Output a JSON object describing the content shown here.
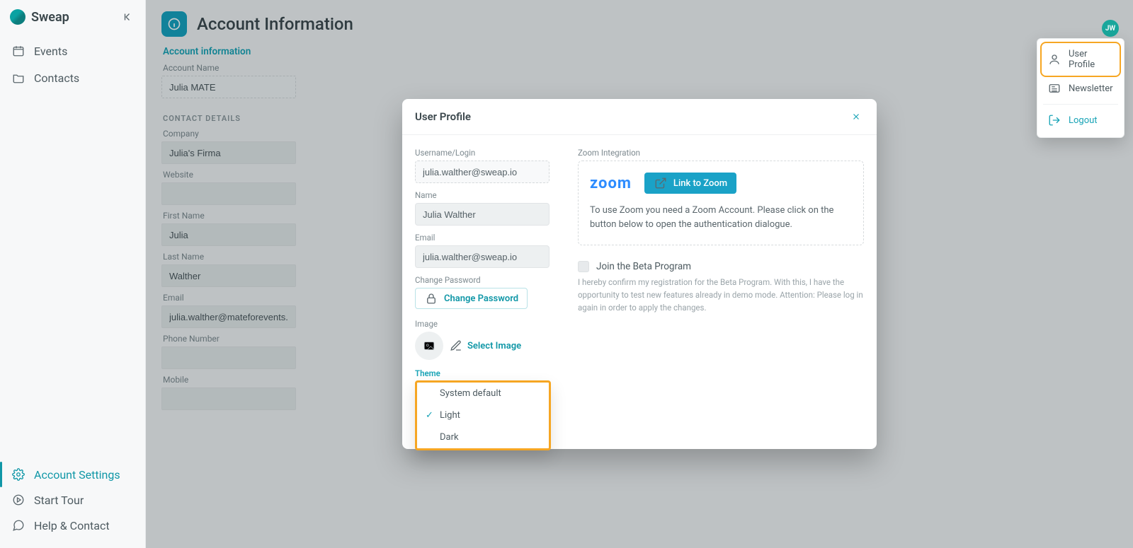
{
  "brand": {
    "name": "Sweap"
  },
  "sidebar": {
    "top": [
      {
        "label": "Events"
      },
      {
        "label": "Contacts"
      }
    ],
    "bottom": [
      {
        "label": "Account Settings"
      },
      {
        "label": "Start Tour"
      },
      {
        "label": "Help & Contact"
      }
    ]
  },
  "avatar": {
    "initials": "JW"
  },
  "menu": {
    "user_profile": "User Profile",
    "newsletter": "Newsletter",
    "logout": "Logout"
  },
  "page": {
    "title": "Account Information",
    "tab": "Account information"
  },
  "account": {
    "account_name_label": "Account Name",
    "account_name_value": "Julia MATE",
    "contact_section": "CONTACT DETAILS",
    "company_label": "Company",
    "company_value": "Julia's Firma",
    "website_label": "Website",
    "website_value": "",
    "first_name_label": "First Name",
    "first_name_value": "Julia",
    "last_name_label": "Last Name",
    "last_name_value": "Walther",
    "email_label": "Email",
    "email_value": "julia.walther@mateforevents.com",
    "phone_label": "Phone Number",
    "phone_value": "",
    "mobile_label": "Mobile",
    "mobile_value": ""
  },
  "modal": {
    "title": "User Profile",
    "username_label": "Username/Login",
    "username_value": "julia.walther@sweap.io",
    "name_label": "Name",
    "name_value": "Julia Walther",
    "email_label": "Email",
    "email_value": "julia.walther@sweap.io",
    "password_label": "Change Password",
    "password_button": "Change Password",
    "image_label": "Image",
    "select_image": "Select Image",
    "theme_label": "Theme",
    "zoom_header": "Zoom Integration",
    "zoom_logo": "zoom",
    "zoom_button": "Link to Zoom",
    "zoom_help": "To use Zoom you need a Zoom Account. Please click on the button below to open the authentication dialogue.",
    "beta_label": "Join the Beta Program",
    "beta_note": "I hereby confirm my registration for the Beta Program. With this, I have the opportunity to test new features already in demo mode. Attention: Please log in again in order to apply the changes."
  },
  "theme_options": {
    "system": "System default",
    "light": "Light",
    "dark": "Dark",
    "selected": "Light"
  }
}
